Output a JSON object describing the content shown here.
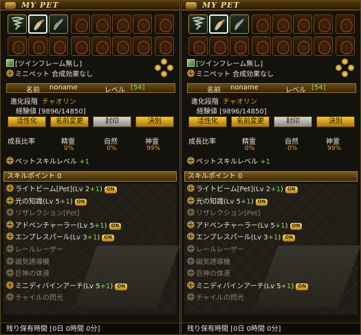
{
  "panels": [
    {
      "title": "MY PET",
      "item_label": "[ツインフレーム無し]",
      "mini_pet": "ミニペット 合成効果なし",
      "name_label": "名前",
      "name_value": "noname",
      "level_label": "レベル",
      "level_value": "[54]",
      "stage_label": "進化段階",
      "stage_value": "チャオリン",
      "exp_label": "経験値",
      "exp_value": "[9896/14850]",
      "buttons": [
        "活性化",
        "名前変更",
        "封印",
        "決別"
      ],
      "growth": {
        "label": "成長比率",
        "columns": [
          {
            "name": "精霊",
            "pct": "0%"
          },
          {
            "name": "自然",
            "pct": "0%"
          },
          {
            "name": "神霊",
            "pct": "99%"
          }
        ]
      },
      "pet_skill_level": "ペットスキルレベル",
      "pet_skill_bonus": "+1",
      "skill_points": "スキルポイント 0",
      "skills": [
        {
          "name": "ライトビーム[Pet](Lv 2",
          "bonus": "+1",
          "tail": ")",
          "on": "ON",
          "enabled": true
        },
        {
          "name": "光の知識(Lv 5",
          "bonus": "+1",
          "tail": ")",
          "on": "ON",
          "enabled": true
        },
        {
          "name": "リザレクション[Pet]",
          "bonus": "",
          "tail": "",
          "on": "",
          "enabled": false
        },
        {
          "name": "アドベンチャーラー(Lv 5",
          "bonus": "+1",
          "tail": ")",
          "on": "ON",
          "enabled": true
        },
        {
          "name": "エンプレスパール(Lv 3",
          "bonus": "+1",
          "tail": ")",
          "on": "ON",
          "enabled": true
        },
        {
          "name": "レールレーザー",
          "bonus": "",
          "tail": "",
          "on": "",
          "enabled": false
        },
        {
          "name": "磁気誘導機",
          "bonus": "",
          "tail": "",
          "on": "",
          "enabled": false
        },
        {
          "name": "巨神の体液",
          "bonus": "",
          "tail": "",
          "on": "",
          "enabled": false
        },
        {
          "name": "ミニディバインアーチ(Lv 5",
          "bonus": "+1",
          "tail": ")",
          "on": "ON",
          "enabled": true
        },
        {
          "name": "チャイルの閃光",
          "bonus": "",
          "tail": "",
          "on": "",
          "enabled": false
        }
      ],
      "footer": "残り保有時間 [0日 0時間 0分]"
    },
    {
      "title": "MY PET",
      "item_label": "[ツインフレーム無し]",
      "mini_pet": "ミニペット 合成効果なし",
      "name_label": "名前",
      "name_value": "noname",
      "level_label": "レベル",
      "level_value": "[54]",
      "stage_label": "進化段階",
      "stage_value": "チャオリン",
      "exp_label": "経験値",
      "exp_value": "[9896/14850]",
      "buttons": [
        "活性化",
        "名前変更",
        "封印",
        "決別"
      ],
      "growth": {
        "label": "成長比率",
        "columns": [
          {
            "name": "精霊",
            "pct": "0%"
          },
          {
            "name": "自然",
            "pct": "0%"
          },
          {
            "name": "神霊",
            "pct": "99%"
          }
        ]
      },
      "pet_skill_level": "ペットスキルレベル",
      "pet_skill_bonus": "+1",
      "skill_points": "スキルポイント 0",
      "skills": [
        {
          "name": "ライトビーム[Pet](Lv 2",
          "bonus": "+1",
          "tail": ")",
          "on": "ON",
          "enabled": true
        },
        {
          "name": "光の知識(Lv 5",
          "bonus": "+1",
          "tail": ")",
          "on": "ON",
          "enabled": true
        },
        {
          "name": "リザレクション[Pet]",
          "bonus": "",
          "tail": "",
          "on": "",
          "enabled": false
        },
        {
          "name": "アドベンチャーラー(Lv 5",
          "bonus": "+1",
          "tail": ")",
          "on": "ON",
          "enabled": true
        },
        {
          "name": "エンプレスパール(Lv 3",
          "bonus": "+1",
          "tail": ")",
          "on": "ON",
          "enabled": true
        },
        {
          "name": "レールレーザー",
          "bonus": "",
          "tail": "",
          "on": "",
          "enabled": false
        },
        {
          "name": "磁気誘導機",
          "bonus": "",
          "tail": "",
          "on": "",
          "enabled": false
        },
        {
          "name": "巨神の体液",
          "bonus": "",
          "tail": "",
          "on": "",
          "enabled": false
        },
        {
          "name": "ミニディバインアーチ(Lv 5",
          "bonus": "+1",
          "tail": ")",
          "on": "ON",
          "enabled": true
        },
        {
          "name": "チャイルの閃光",
          "bonus": "",
          "tail": "",
          "on": "",
          "enabled": false
        }
      ],
      "footer": "残り保有時間 [0日 0時間 0分]"
    }
  ]
}
